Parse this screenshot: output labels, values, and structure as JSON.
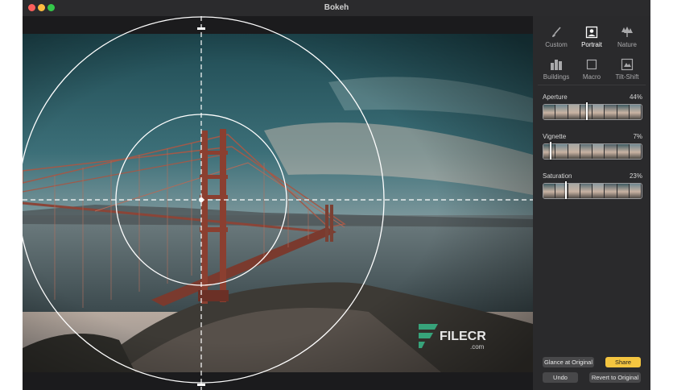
{
  "window": {
    "title": "Bokeh"
  },
  "colors": {
    "accent": "#f4c540",
    "close": "#fc605c",
    "minimize": "#fdbc40",
    "zoom": "#34c84a"
  },
  "presets": [
    {
      "label": "Custom",
      "icon": "brush-icon",
      "active": false
    },
    {
      "label": "Portrait",
      "icon": "portrait-icon",
      "active": true
    },
    {
      "label": "Nature",
      "icon": "trees-icon",
      "active": false
    },
    {
      "label": "Buildings",
      "icon": "buildings-icon",
      "active": false
    },
    {
      "label": "Macro",
      "icon": "square-icon",
      "active": false
    },
    {
      "label": "Tilt-Shift",
      "icon": "tilt-shift-icon",
      "active": false
    }
  ],
  "sliders": [
    {
      "label": "Aperture",
      "value": "44%",
      "fraction": 0.44
    },
    {
      "label": "Vignette",
      "value": "7%",
      "fraction": 0.07
    },
    {
      "label": "Saturation",
      "value": "23%",
      "fraction": 0.23
    }
  ],
  "buttons": {
    "glance": "Glance at Original",
    "share": "Share",
    "undo": "Undo",
    "revert": "Revert to Original"
  },
  "watermark": {
    "brand": "FILECR",
    "suffix": ".com"
  }
}
